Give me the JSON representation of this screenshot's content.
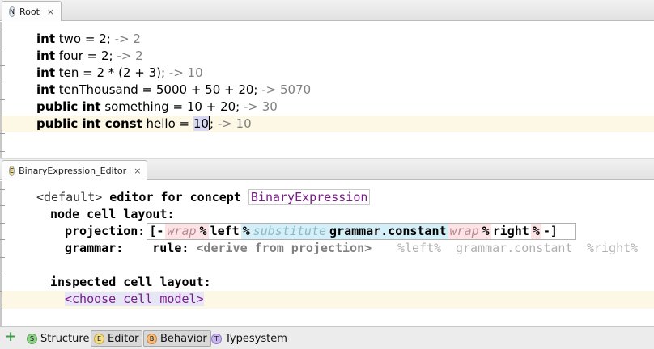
{
  "top_tab": {
    "icon_letter": "N",
    "label": "Root",
    "close": "×"
  },
  "root_editor": {
    "lines": [
      {
        "kw": "int",
        "rest": " two = 2;",
        "result": " -> 2"
      },
      {
        "kw": "int",
        "rest": " four = 2;",
        "result": " -> 2"
      },
      {
        "kw": "int",
        "rest": " ten = 2 * (2 + 3);",
        "result": " -> 10"
      },
      {
        "kw": "int",
        "rest": " tenThousand = 5000 + 50 + 20;",
        "result": " -> 5070"
      },
      {
        "kw": "public int",
        "rest": " something = 10 + 20;",
        "result": " -> 30"
      },
      {
        "kw": "public int const",
        "rest": " hello = ",
        "selected": "10",
        "after": ";",
        "result": " -> 10"
      }
    ]
  },
  "editor_tab": {
    "icon_letter": "E",
    "label": "BinaryExpression_Editor",
    "close": "×"
  },
  "concept_editor": {
    "header_default": "<default>",
    "header_text": " editor for concept ",
    "concept_name": "BinaryExpression",
    "node_cell_layout": "node cell layout:",
    "projection_label": "projection:",
    "cells": [
      "[-",
      "wrap",
      "%",
      "left",
      "%",
      "substitute",
      "grammar.constant",
      "wrap",
      "%",
      "right",
      "%",
      "-]"
    ],
    "grammar_label": "grammar:",
    "rule_label": "rule:",
    "rule_value": "<derive from projection>",
    "grammar_hint_left": "%left%",
    "grammar_hint_constant": "grammar.constant",
    "grammar_hint_right": "%right%",
    "inspected_label": "inspected cell layout:",
    "choose_cell_model": "<choose cell model>"
  },
  "bottom_bar": {
    "plus": "+",
    "aspects": [
      {
        "letter": "S",
        "label": "Structure",
        "color": "#8fd18a"
      },
      {
        "letter": "E",
        "label": "Editor",
        "color": "#f3de8a"
      },
      {
        "letter": "B",
        "label": "Behavior",
        "color": "#f5b97a"
      },
      {
        "letter": "T",
        "label": "Typesystem",
        "color": "#c8b6ef"
      }
    ]
  }
}
